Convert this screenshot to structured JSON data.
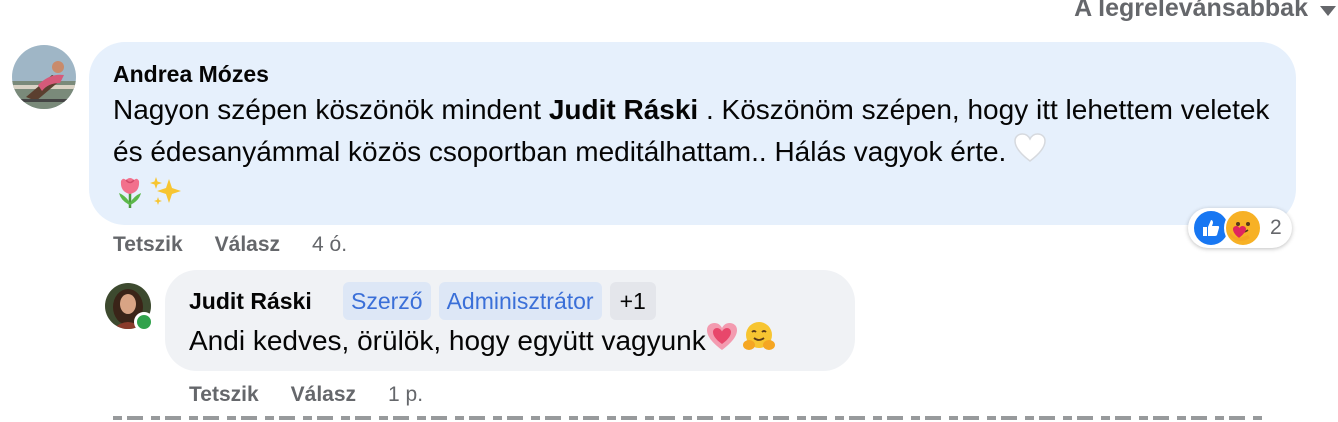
{
  "sort": {
    "label": "A legrelevánsabbak"
  },
  "comments": [
    {
      "author": "Andrea Mózes",
      "text_before": "Nagyon szépen köszönök mindent ",
      "mention": "Judit Ráski",
      "text_after": " . Köszönöm szépen, hogy itt lehettem veletek és édesanyámmal közös csoportban meditálhattam.. Hálás vagyok érte. ",
      "emojis": [
        "white-heart-icon",
        "tulip-icon",
        "sparkles-icon"
      ],
      "actions": {
        "like": "Tetszik",
        "reply": "Válasz",
        "time": "4 ó."
      },
      "reactions": {
        "icons": [
          "like-icon",
          "care-icon"
        ],
        "count": "2"
      }
    },
    {
      "author": "Judit Ráski",
      "badges": [
        "Szerző",
        "Adminisztrátor",
        "+1"
      ],
      "text": "Andi kedves, örülök, hogy együtt vagyunk",
      "emojis": [
        "sparkling-heart-icon",
        "hugging-face-icon"
      ],
      "actions": {
        "like": "Tetszik",
        "reply": "Válasz",
        "time": "1 p."
      },
      "online": true
    }
  ],
  "colors": {
    "bubble_highlight": "#e6f0fc",
    "bubble": "#f0f2f5",
    "badge_text": "#3a6fd8",
    "badge_bg": "#dde7f6",
    "like": "#1877f2",
    "online": "#31a24c"
  }
}
